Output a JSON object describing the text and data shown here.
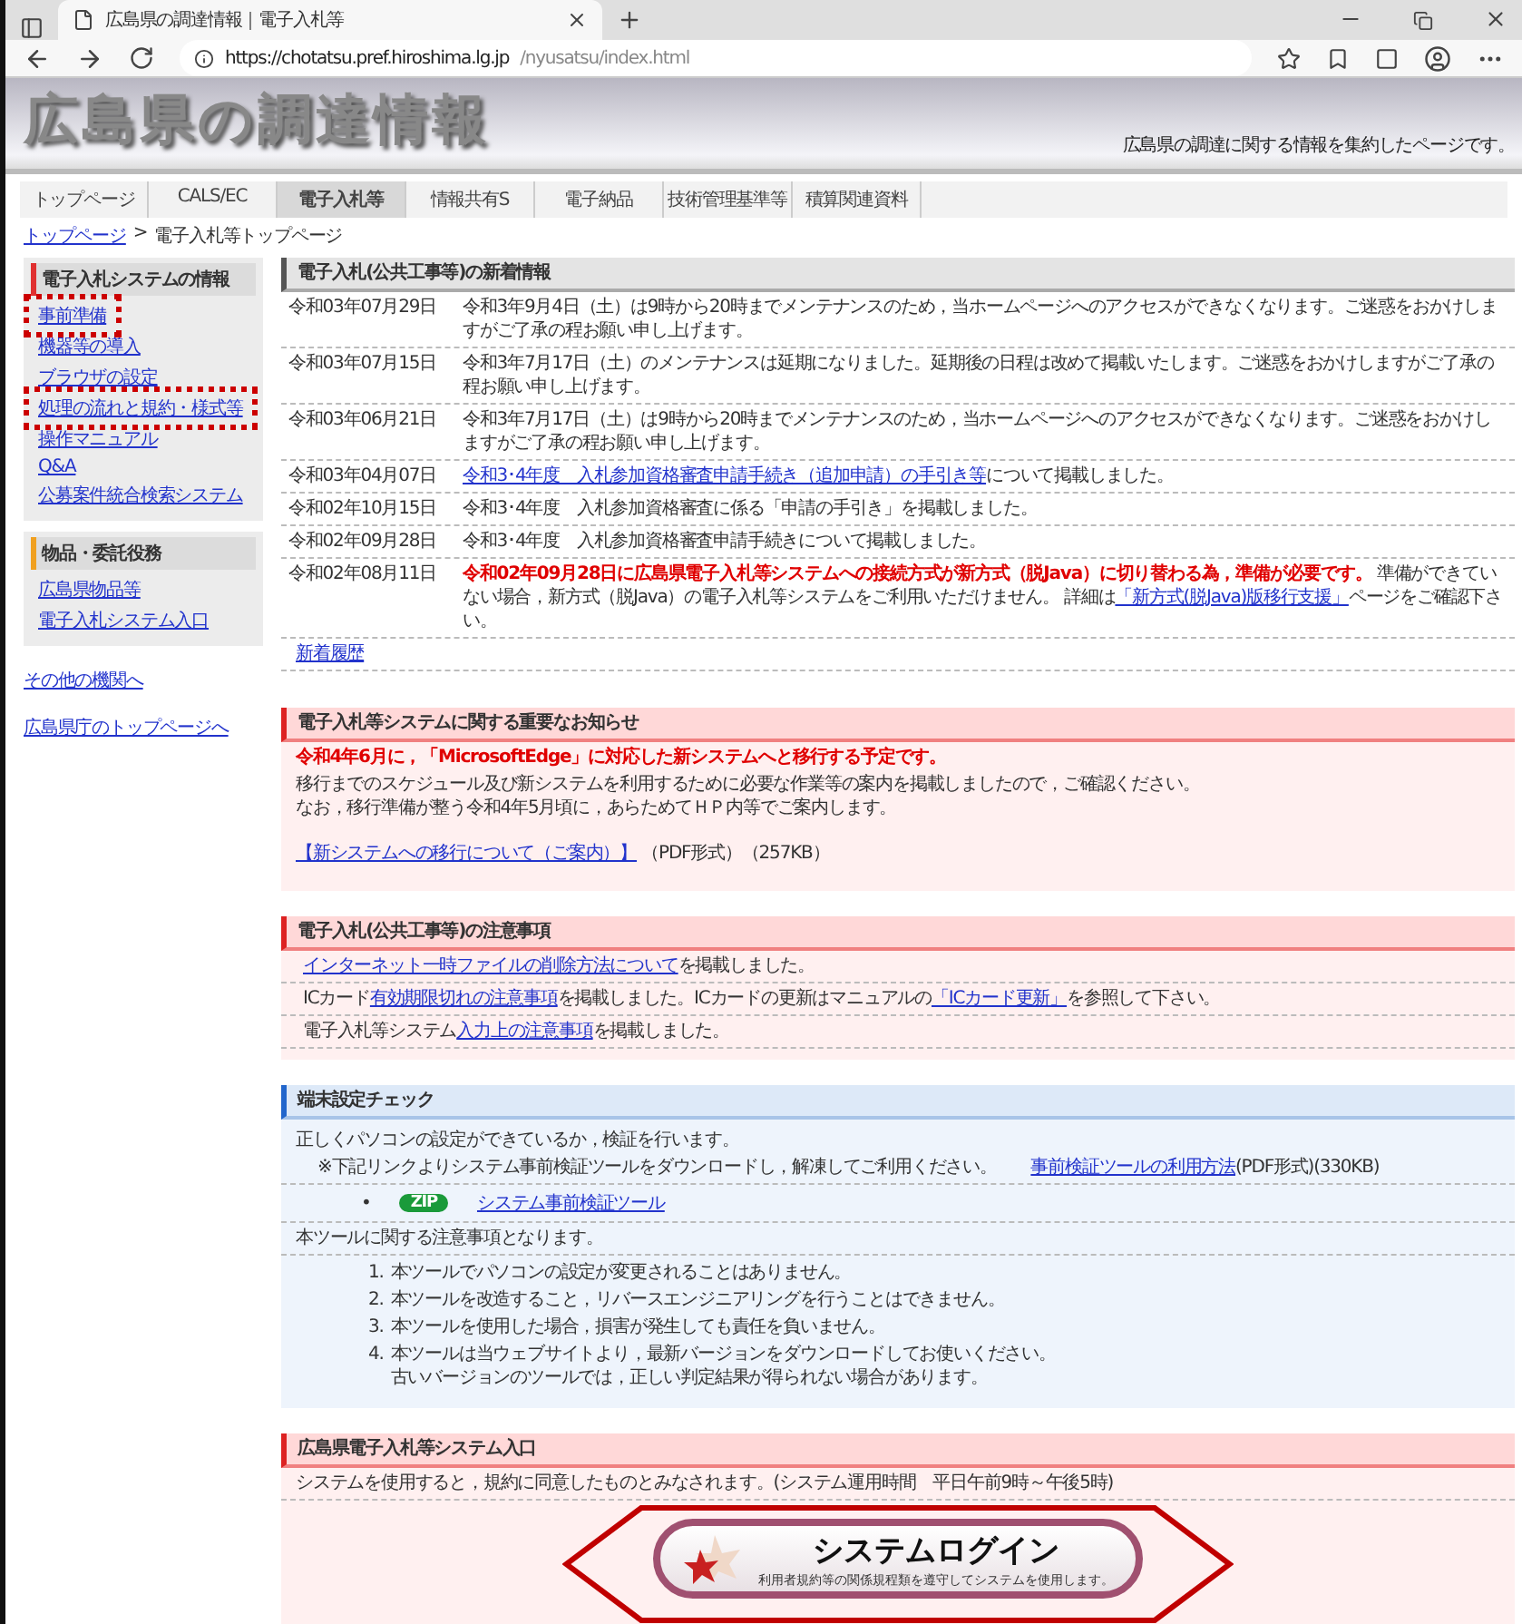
{
  "browser": {
    "tab_title": "広島県の調達情報｜電子入札等",
    "url_host": "https://chotatsu.pref.hiroshima.lg.jp",
    "url_path": "/nyusatsu/index.html"
  },
  "site": {
    "title": "広島県の調達情報",
    "tagline": "広島県の調達に関する情報を集約したページです。"
  },
  "nav": [
    {
      "label": "トップページ",
      "selected": false
    },
    {
      "label": "CALS/EC",
      "selected": false
    },
    {
      "label": "電子入札等",
      "selected": true
    },
    {
      "label": "情報共有S",
      "selected": false
    },
    {
      "label": "電子納品",
      "selected": false
    },
    {
      "label": "技術管理基準等",
      "selected": false
    },
    {
      "label": "積算関連資料",
      "selected": false
    }
  ],
  "breadcrumb": {
    "link": "トップページ",
    "separator": ">",
    "current": "電子入札等トップページ"
  },
  "sidebar": {
    "sections": [
      {
        "title": "電子入札システムの情報",
        "color": "#e03030",
        "items": [
          {
            "label": "事前準備",
            "highlighted": true
          },
          {
            "label": "機器等の導入",
            "highlighted": false
          },
          {
            "label": "ブラウザの設定",
            "highlighted": false
          },
          {
            "label": "処理の流れと規約・様式等",
            "highlighted": true
          },
          {
            "label": "操作マニュアル",
            "highlighted": false
          },
          {
            "label": "Q&A",
            "highlighted": false
          },
          {
            "label": "公募案件統合検索システム",
            "highlighted": false
          }
        ]
      },
      {
        "title": "物品・委託役務",
        "color": "#f0a020",
        "items": [
          {
            "label": "広島県物品等",
            "highlighted": false
          },
          {
            "label": "電子入札システム入口",
            "highlighted": false
          }
        ]
      }
    ],
    "links": [
      "その他の機関へ",
      "広島県庁のトップページへ"
    ]
  },
  "news": {
    "title": "電子入札(公共工事等)の新着情報",
    "items": [
      {
        "date": "令和03年07月29日",
        "parts": [
          {
            "kind": "plain",
            "text": "令和3年9月4日（土）は9時から20時までメンテナンスのため，当ホームページへのアクセスができなくなります。ご迷惑をおかけしますがご了承の程お願い申し上げます。"
          }
        ]
      },
      {
        "date": "令和03年07月15日",
        "parts": [
          {
            "kind": "plain",
            "text": "令和3年7月17日（土）のメンテナンスは延期になりました。延期後の日程は改めて掲載いたします。ご迷惑をおかけしますがご了承の程お願い申し上げます。"
          }
        ]
      },
      {
        "date": "令和03年06月21日",
        "parts": [
          {
            "kind": "plain",
            "text": "令和3年7月17日（土）は9時から20時までメンテナンスのため，当ホームページへのアクセスができなくなります。ご迷惑をおかけしますがご了承の程お願い申し上げます。"
          }
        ]
      },
      {
        "date": "令和03年04月07日",
        "parts": [
          {
            "kind": "link",
            "text": "令和3･4年度　入札参加資格審査申請手続き（追加申請）の手引き等"
          },
          {
            "kind": "plain",
            "text": "について掲載しました。"
          }
        ]
      },
      {
        "date": "令和02年10月15日",
        "parts": [
          {
            "kind": "plain",
            "text": "令和3･4年度　入札参加資格審査に係る「申請の手引き」を掲載しました。"
          }
        ]
      },
      {
        "date": "令和02年09月28日",
        "parts": [
          {
            "kind": "plain",
            "text": "令和3･4年度　入札参加資格審査申請手続きについて掲載しました。"
          }
        ]
      },
      {
        "date": "令和02年08月11日",
        "parts": [
          {
            "kind": "alert",
            "text": "令和02年09月28日に広島県電子入札等システムへの接続方式が新方式（脱Java）に切り替わる為，準備が必要です。"
          },
          {
            "kind": "plain",
            "text": " 準備ができていない場合，新方式（脱Java）の電子入札等システムをご利用いただけません。 詳細は"
          },
          {
            "kind": "link",
            "text": "「新方式(脱Java)版移行支援」"
          },
          {
            "kind": "plain",
            "text": "ページをご確認下さい。"
          }
        ]
      }
    ],
    "more_link": "新着履歴"
  },
  "notice": {
    "title": "電子入札等システムに関する重要なお知らせ",
    "alert": "令和4年6月に，「MicrosoftEdge」に対応した新システムへと移行する予定です。",
    "lines": [
      "移行までのスケジュール及び新システムを利用するために必要な作業等の案内を掲載しましたので，ご確認ください。",
      "なお，移行準備が整う令和4年5月頃に，あらためてＨＰ内等でご案内します。"
    ],
    "link": "【新システムへの移行について（ご案内）】",
    "note": "（PDF形式）（257KB）"
  },
  "cautions": {
    "title": "電子入札(公共工事等)の注意事項",
    "items": [
      {
        "parts": [
          {
            "kind": "link",
            "text": "インターネット一時ファイルの削除方法について"
          },
          {
            "kind": "plain",
            "text": "を掲載しました。"
          }
        ]
      },
      {
        "parts": [
          {
            "kind": "plain",
            "text": "ICカード"
          },
          {
            "kind": "link",
            "text": "有効期限切れの注意事項"
          },
          {
            "kind": "plain",
            "text": "を掲載しました。ICカードの更新はマニュアルの"
          },
          {
            "kind": "link",
            "text": "「ICカード更新」"
          },
          {
            "kind": "plain",
            "text": "を参照して下さい。"
          }
        ]
      },
      {
        "parts": [
          {
            "kind": "plain",
            "text": "電子入札等システム"
          },
          {
            "kind": "link",
            "text": "入力上の注意事項"
          },
          {
            "kind": "plain",
            "text": "を掲載しました。"
          }
        ]
      }
    ]
  },
  "check": {
    "title": "端末設定チェック",
    "intro": "正しくパソコンの設定ができているか，検証を行います。",
    "note": [
      {
        "kind": "plain",
        "text": "※下記リンクよりシステム事前検証ツールをダウンロードし，解凍してご利用ください。　　"
      },
      {
        "kind": "link",
        "text": "事前検証ツールの利用方法"
      },
      {
        "kind": "plain",
        "text": "(PDF形式)(330KB)"
      }
    ],
    "download": {
      "bullet": "•",
      "badge": "ZIP",
      "link": "システム事前検証ツール"
    },
    "caution_title": "本ツールに関する注意事項となります。",
    "rules": [
      {
        "number": "1.",
        "text": "本ツールでパソコンの設定が変更されることはありません。"
      },
      {
        "number": "2.",
        "text": "本ツールを改造すること，リバースエンジニアリングを行うことはできません。"
      },
      {
        "number": "3.",
        "text": "本ツールを使用した場合，損害が発生しても責任を負いません。"
      },
      {
        "number": "4.",
        "text": "本ツールは当ウェブサイトより，最新バージョンをダウンロードしてお使いください。",
        "more": "古いバージョンのツールでは，正しい判定結果が得られない場合があります。"
      }
    ]
  },
  "entrance": {
    "title": "広島県電子入札等システム入口",
    "text": "システムを使用すると，規約に同意したものとみなされます。(システム運用時間　平日午前9時～午後5時)",
    "login": {
      "title": "システムログイン",
      "subtitle": "利用者規約等の関係規程類を遵守してシステムを使用します。",
      "highlighted": true
    }
  }
}
